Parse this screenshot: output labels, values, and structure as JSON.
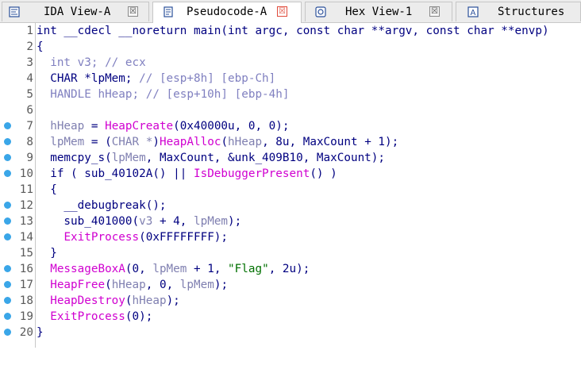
{
  "tabs": [
    {
      "label": "IDA View-A",
      "icon": "ida-view-icon",
      "close": "☒",
      "active": false
    },
    {
      "label": "Pseudocode-A",
      "icon": "pseudocode-icon",
      "close": "☒",
      "active": true
    },
    {
      "label": "Hex View-1",
      "icon": "hex-view-icon",
      "close": "☒",
      "active": false
    },
    {
      "label": "Structures",
      "icon": "structures-icon",
      "close": "",
      "active": false
    }
  ],
  "colors": {
    "breakpoint": "#3aa6e8",
    "keyword": "#000080",
    "comment": "#8080c0",
    "import": "#d000d0",
    "string": "#007000"
  },
  "code": {
    "lines": [
      {
        "num": "1",
        "bp": false,
        "segs": [
          {
            "t": "int __cdecl __noreturn main(int argc, const char **argv, const char **envp)",
            "c": "plain"
          }
        ]
      },
      {
        "num": "2",
        "bp": false,
        "segs": [
          {
            "t": "{",
            "c": "plain"
          }
        ]
      },
      {
        "num": "3",
        "bp": false,
        "segs": [
          {
            "t": "  int v3; // ecx",
            "c": "cmt"
          }
        ]
      },
      {
        "num": "4",
        "bp": false,
        "segs": [
          {
            "t": "  CHAR *lpMem; ",
            "c": "plain"
          },
          {
            "t": "// [esp+8h] [ebp-Ch]",
            "c": "cmt"
          }
        ]
      },
      {
        "num": "5",
        "bp": false,
        "segs": [
          {
            "t": "  HANDLE hHeap; // [esp+10h] [ebp-4h]",
            "c": "cmt"
          }
        ]
      },
      {
        "num": "6",
        "bp": false,
        "segs": [
          {
            "t": "",
            "c": "plain"
          }
        ]
      },
      {
        "num": "7",
        "bp": true,
        "segs": [
          {
            "t": "  hHeap",
            "c": "var"
          },
          {
            "t": " = ",
            "c": "plain"
          },
          {
            "t": "HeapCreate",
            "c": "imp"
          },
          {
            "t": "(0x40000u, 0, 0);",
            "c": "plain"
          }
        ]
      },
      {
        "num": "8",
        "bp": true,
        "segs": [
          {
            "t": "  lpMem",
            "c": "var"
          },
          {
            "t": " = (",
            "c": "plain"
          },
          {
            "t": "CHAR *",
            "c": "var"
          },
          {
            "t": ")",
            "c": "plain"
          },
          {
            "t": "HeapAlloc",
            "c": "imp"
          },
          {
            "t": "(",
            "c": "plain"
          },
          {
            "t": "hHeap",
            "c": "var"
          },
          {
            "t": ", 8u, MaxCount + 1);",
            "c": "plain"
          }
        ]
      },
      {
        "num": "9",
        "bp": true,
        "segs": [
          {
            "t": "  memcpy_s(",
            "c": "plain"
          },
          {
            "t": "lpMem",
            "c": "var"
          },
          {
            "t": ", MaxCount, &unk_409B10, MaxCount);",
            "c": "plain"
          }
        ]
      },
      {
        "num": "10",
        "bp": true,
        "segs": [
          {
            "t": "  if ( sub_40102A() || ",
            "c": "plain"
          },
          {
            "t": "IsDebuggerPresent",
            "c": "imp"
          },
          {
            "t": "() )",
            "c": "plain"
          }
        ]
      },
      {
        "num": "11",
        "bp": false,
        "segs": [
          {
            "t": "  {",
            "c": "plain"
          }
        ]
      },
      {
        "num": "12",
        "bp": true,
        "segs": [
          {
            "t": "    __debugbreak();",
            "c": "plain"
          }
        ]
      },
      {
        "num": "13",
        "bp": true,
        "segs": [
          {
            "t": "    sub_401000(",
            "c": "plain"
          },
          {
            "t": "v3",
            "c": "var"
          },
          {
            "t": " + 4, ",
            "c": "plain"
          },
          {
            "t": "lpMem",
            "c": "var"
          },
          {
            "t": ");",
            "c": "plain"
          }
        ]
      },
      {
        "num": "14",
        "bp": true,
        "segs": [
          {
            "t": "    ",
            "c": "plain"
          },
          {
            "t": "ExitProcess",
            "c": "imp"
          },
          {
            "t": "(0xFFFFFFFF);",
            "c": "plain"
          }
        ]
      },
      {
        "num": "15",
        "bp": false,
        "segs": [
          {
            "t": "  }",
            "c": "plain"
          }
        ]
      },
      {
        "num": "16",
        "bp": true,
        "segs": [
          {
            "t": "  ",
            "c": "plain"
          },
          {
            "t": "MessageBoxA",
            "c": "imp"
          },
          {
            "t": "(0, ",
            "c": "plain"
          },
          {
            "t": "lpMem",
            "c": "var"
          },
          {
            "t": " + 1, ",
            "c": "plain"
          },
          {
            "t": "\"Flag\"",
            "c": "str"
          },
          {
            "t": ", 2u);",
            "c": "plain"
          }
        ]
      },
      {
        "num": "17",
        "bp": true,
        "segs": [
          {
            "t": "  ",
            "c": "plain"
          },
          {
            "t": "HeapFree",
            "c": "imp"
          },
          {
            "t": "(",
            "c": "plain"
          },
          {
            "t": "hHeap",
            "c": "var"
          },
          {
            "t": ", 0, ",
            "c": "plain"
          },
          {
            "t": "lpMem",
            "c": "var"
          },
          {
            "t": ");",
            "c": "plain"
          }
        ]
      },
      {
        "num": "18",
        "bp": true,
        "segs": [
          {
            "t": "  ",
            "c": "plain"
          },
          {
            "t": "HeapDestroy",
            "c": "imp"
          },
          {
            "t": "(",
            "c": "plain"
          },
          {
            "t": "hHeap",
            "c": "var"
          },
          {
            "t": ");",
            "c": "plain"
          }
        ]
      },
      {
        "num": "19",
        "bp": true,
        "segs": [
          {
            "t": "  ",
            "c": "plain"
          },
          {
            "t": "ExitProcess",
            "c": "imp"
          },
          {
            "t": "(0);",
            "c": "plain"
          }
        ]
      },
      {
        "num": "20",
        "bp": true,
        "segs": [
          {
            "t": "}",
            "c": "plain"
          }
        ]
      }
    ]
  }
}
